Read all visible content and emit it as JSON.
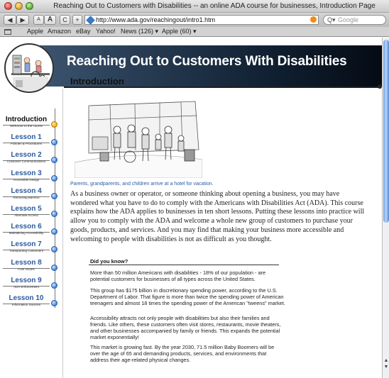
{
  "window": {
    "title": "Reaching Out to Customers with Disabilities -- an online ADA course for businesses, Introduction Page"
  },
  "toolbar": {
    "back": "◀",
    "forward": "▶",
    "text_smaller": "A",
    "text_larger": "A",
    "reload": "C",
    "add": "+",
    "url": "http://www.ada.gov/reachingout/intro1.htm",
    "search_placeholder": "Google",
    "search_glyph": "Q▾"
  },
  "bookmarks": {
    "items": [
      "Apple",
      "Amazon",
      "eBay",
      "Yahoo!",
      "News (126) ▾",
      "Apple (60) ▾"
    ]
  },
  "banner": {
    "title": "Reaching Out to Customers With Disabilities"
  },
  "page": {
    "heading": "Introduction",
    "caption": "Parents, grandparents, and children arrive at a hotel for vacation.",
    "body": "As a business owner or operator, or someone thinking about opening a business, you may have wondered what you have to do to comply with the Americans with Disabilities Act (ADA). This course explains how the ADA applies to businesses in ten short lessons. Putting these lessons into practice will allow you to comply with the ADA and welcome a whole new group of customers to purchase your goods, products, and services. And you may find that making your business more accessible and welcoming to people with disabilities is not as difficult as you thought."
  },
  "nav": {
    "items": [
      {
        "title": "Introduction",
        "subtitle": "Welcome to the course",
        "active": true
      },
      {
        "title": "Lesson 1",
        "subtitle": "Policies & Procedures",
        "active": false
      },
      {
        "title": "Lesson 2",
        "subtitle": "Customer Communications",
        "active": false
      },
      {
        "title": "Lesson 3",
        "subtitle": "Accessible Design",
        "active": false
      },
      {
        "title": "Lesson 4",
        "subtitle": "Removing Barriers",
        "active": false
      },
      {
        "title": "Lesson 5",
        "subtitle": "Alternate Access",
        "active": false
      },
      {
        "title": "Lesson 6",
        "subtitle": "Maintaining Accessibility",
        "active": false
      },
      {
        "title": "Lesson 7",
        "subtitle": "Transporting Customers",
        "active": false
      },
      {
        "title": "Lesson 8",
        "subtitle": "Cost Issues",
        "active": false
      },
      {
        "title": "Lesson 9",
        "subtitle": "ADA Enforcement",
        "active": false
      },
      {
        "title": "Lesson 10",
        "subtitle": "Information Sources",
        "active": false
      }
    ]
  },
  "did_you_know": {
    "title": "Did you know?",
    "paragraphs": [
      "More than 50 million Americans with disabilities - 18% of our population - are potential customers for businesses of all types across the United States.",
      "This group has $175 billion in discretionary spending power, according to the U.S. Department of Labor. That figure is more than twice the spending power of American teenagers and almost 18 times the spending power of the American \"tweens\" market.",
      "Accessibility attracts not only people with disabilities but also their families and friends. Like others, these customers often visit stores, restaurants, movie theaters, and other businesses accompanied by family or friends. This expands the potential market exponentially!",
      "This market is growing fast. By the year 2030, 71.5 million Baby Boomers will be over the age of 65 and demanding products, services, and environments that address their age-related physical changes."
    ]
  },
  "colors": {
    "link_blue": "#2c5aa0",
    "active_dot": "#f2a81a",
    "banner_dark": "#0f1e2f"
  }
}
